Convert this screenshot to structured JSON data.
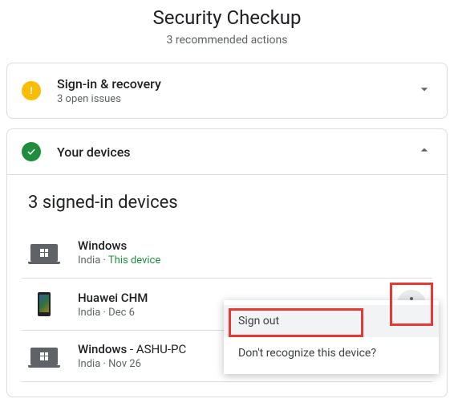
{
  "header": {
    "title": "Security Checkup",
    "subtitle": "3 recommended actions"
  },
  "signin_card": {
    "title": "Sign-in & recovery",
    "subtitle": "3 open issues"
  },
  "devices_card": {
    "title": "Your devices",
    "section_title": "3 signed-in devices",
    "devices": [
      {
        "name": "Windows",
        "suffix": "",
        "location": "India",
        "detail_label": "This device",
        "detail_is_current": true
      },
      {
        "name": "Huawei CHM",
        "suffix": "",
        "location": "India",
        "detail_label": "Dec 6",
        "detail_is_current": false
      },
      {
        "name": "Windows",
        "suffix": " - ASHU-PC",
        "location": "India",
        "detail_label": "Nov 26",
        "detail_is_current": false
      }
    ]
  },
  "popup": {
    "sign_out": "Sign out",
    "dont_recognize": "Don't recognize this device?"
  }
}
